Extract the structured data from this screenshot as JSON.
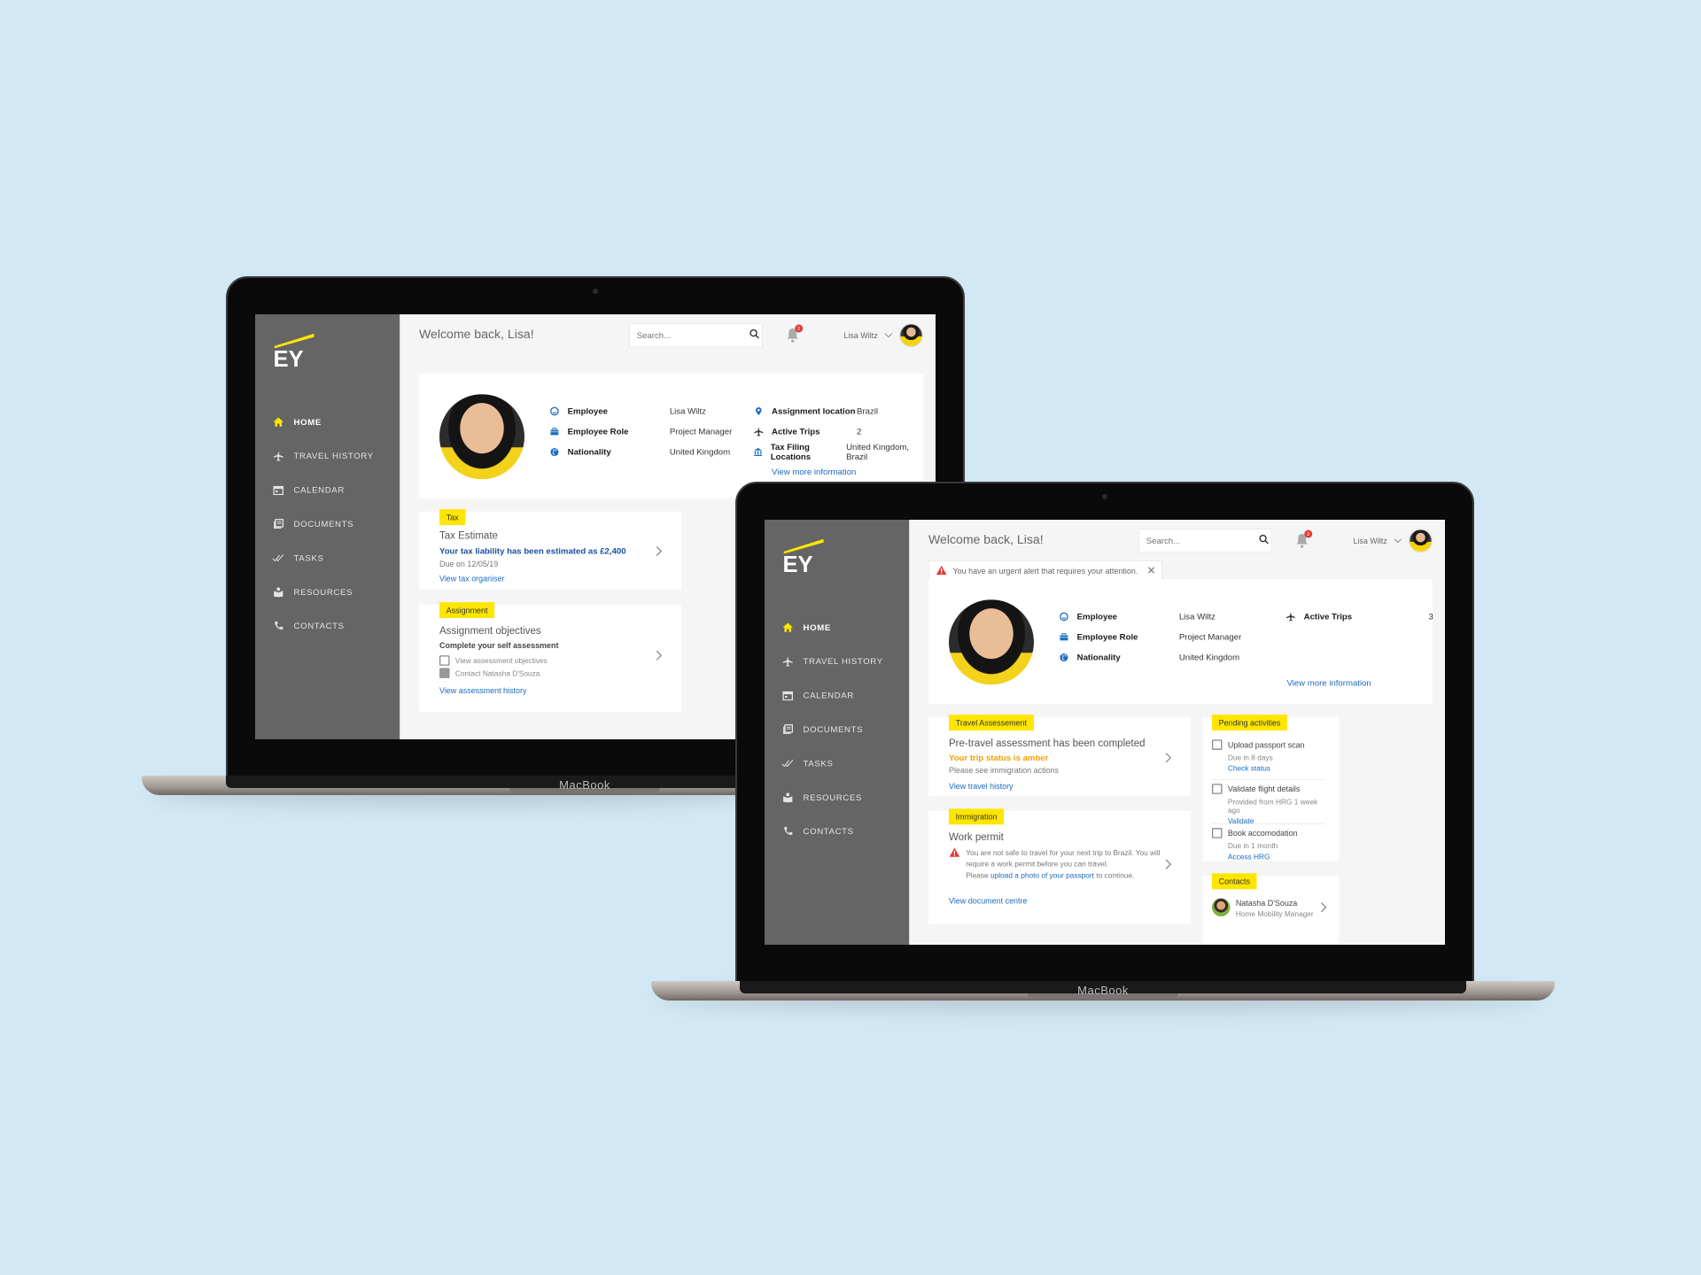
{
  "colors": {
    "accent": "#ffe600",
    "sidebar": "#656565",
    "link": "#1a6bc0",
    "amber": "#f5a000",
    "danger": "#e53935"
  },
  "brand": "MacBook",
  "nav": [
    {
      "label": "HOME",
      "icon": "home-icon"
    },
    {
      "label": "TRAVEL HISTORY",
      "icon": "airplane-icon"
    },
    {
      "label": "CALENDAR",
      "icon": "calendar-icon"
    },
    {
      "label": "DOCUMENTS",
      "icon": "documents-icon"
    },
    {
      "label": "TASKS",
      "icon": "tasks-icon"
    },
    {
      "label": "RESOURCES",
      "icon": "resources-icon"
    },
    {
      "label": "CONTACTS",
      "icon": "phone-icon"
    }
  ],
  "header": {
    "welcome": "Welcome back, Lisa!",
    "search_placeholder": "Search...",
    "notifications_count": "2",
    "user_name": "Lisa Wiltz",
    "alert_text": "You have an urgent alert that requires your attention."
  },
  "back": {
    "profile": {
      "rows_left": [
        {
          "key": "Employee",
          "value": "Lisa Wiltz",
          "icon": "smiley-icon"
        },
        {
          "key": "Employee Role",
          "value": "Project Manager",
          "icon": "briefcase-icon"
        },
        {
          "key": "Nationality",
          "value": "United Kingdom",
          "icon": "globe-icon"
        }
      ],
      "rows_right": [
        {
          "key": "Assignment location",
          "value": "Brazil",
          "icon": "location-pin-icon"
        },
        {
          "key": "Active Trips",
          "value": "2",
          "icon": "airplane-icon"
        },
        {
          "key": "Tax Filing Locations",
          "value": "United Kingdom, Brazil",
          "icon": "bank-icon"
        }
      ],
      "more_link": "View more information"
    },
    "tax": {
      "tag": "Tax",
      "title": "Tax Estimate",
      "status": "Your tax liability has been estimated as £2,400",
      "due": "Due on 12/05/19",
      "link": "View tax organiser"
    },
    "assignment": {
      "tag": "Assignment",
      "title": "Assignment objectives",
      "task": "Complete your self assessment",
      "items": [
        "View assessment objectives",
        "Contact Natasha D'Souza"
      ],
      "link": "View assessment history"
    }
  },
  "front": {
    "profile": {
      "rows_left": [
        {
          "key": "Employee",
          "value": "Lisa Wiltz",
          "icon": "smiley-icon"
        },
        {
          "key": "Employee Role",
          "value": "Project Manager",
          "icon": "briefcase-icon"
        },
        {
          "key": "Nationality",
          "value": "United Kingdom",
          "icon": "globe-icon"
        }
      ],
      "rows_right": [
        {
          "key": "Active Trips",
          "value": "3",
          "icon": "airplane-icon"
        }
      ],
      "more_link": "View more information"
    },
    "travel": {
      "tag": "Travel Assessement",
      "title": "Pre-travel assessment has been completed",
      "status": "Your trip status is amber",
      "sub": "Please see immigration actions",
      "link": "View travel history"
    },
    "immigration": {
      "tag": "Immigration",
      "title": "Work permit",
      "warning_line1": "You are not safe to travel for your next trip to Brazil. You will",
      "warning_line2": "require a work permit before you can travel.",
      "warning_pre": "Please",
      "warning_link": "upload a photo of your passport",
      "warning_post": "to continue.",
      "link": "View document centre"
    },
    "pending": {
      "tag": "Pending activities",
      "items": [
        {
          "title": "Upload passport scan",
          "sub": "Due in 8 days",
          "link": "Check status"
        },
        {
          "title": "Validate flight details",
          "sub": "Provided from HRG 1 week ago",
          "link": "Validate"
        },
        {
          "title": "Book accomodation",
          "sub": "Due in 1 month",
          "link": "Access HRG"
        }
      ]
    },
    "contacts": {
      "tag": "Contacts",
      "name": "Natasha D'Souza",
      "role": "Home Mobility Manager"
    }
  }
}
